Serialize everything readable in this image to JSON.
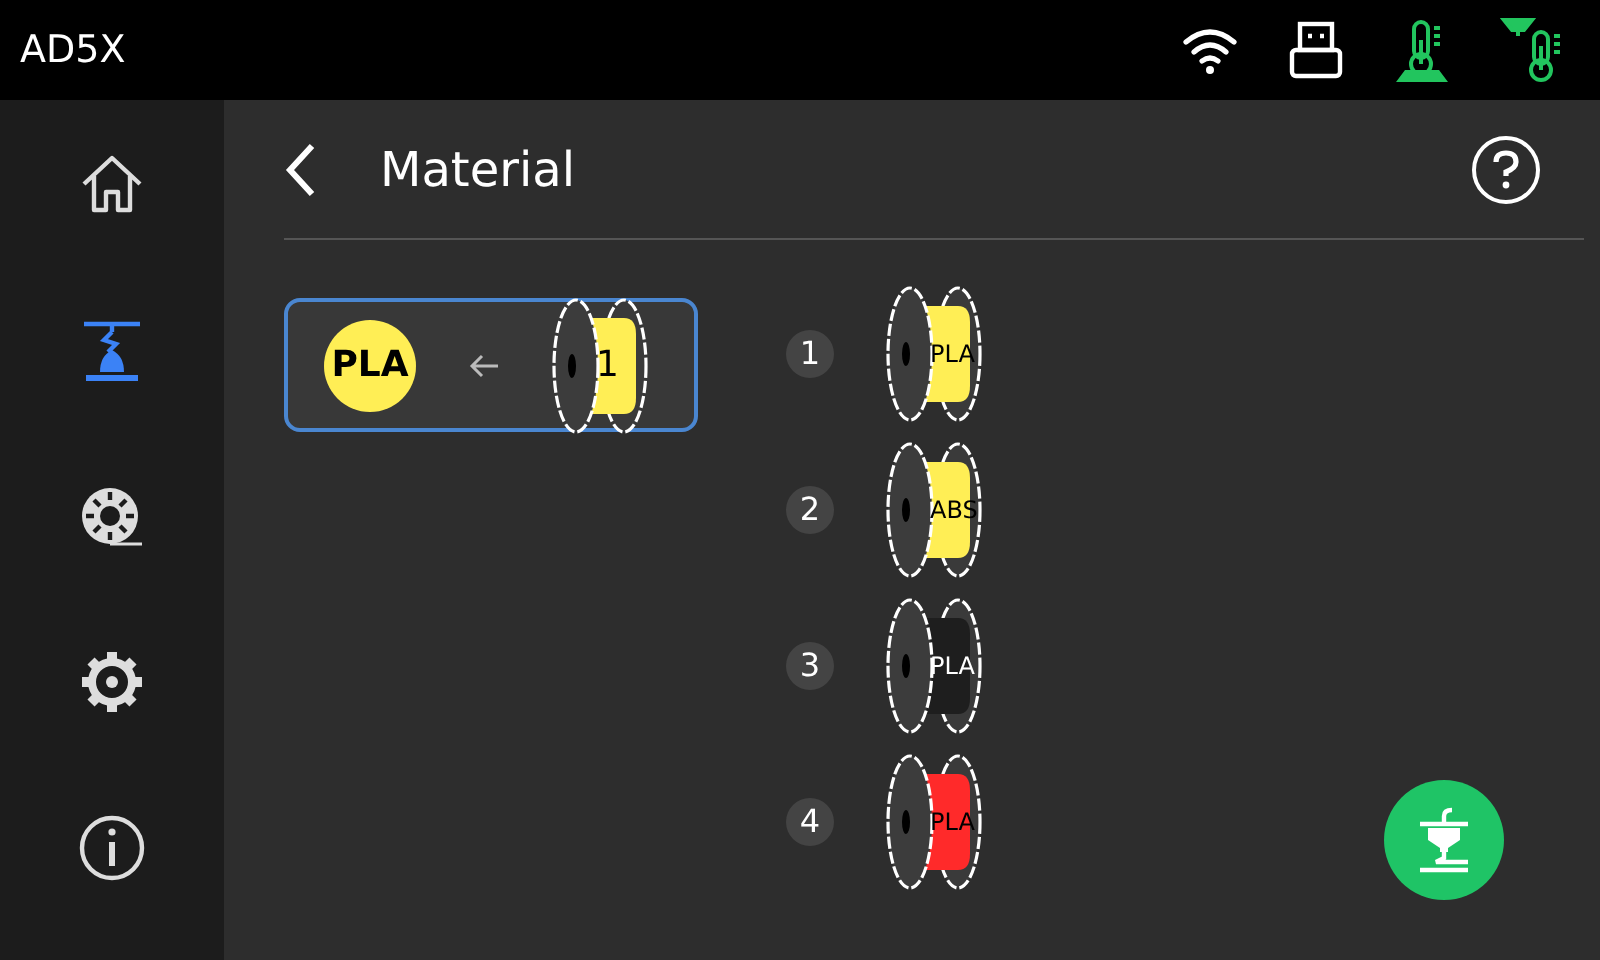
{
  "top_bar": {
    "title": "AD5X"
  },
  "sidebar": {
    "items": [
      {
        "kind": "home",
        "selected": false
      },
      {
        "kind": "print",
        "selected": true
      },
      {
        "kind": "filament",
        "selected": false
      },
      {
        "kind": "settings",
        "selected": false
      },
      {
        "kind": "info",
        "selected": false
      }
    ]
  },
  "header": {
    "title": "Material"
  },
  "active_slot": {
    "material": "PLA",
    "color": "#ffee55",
    "slot": "1"
  },
  "slots": [
    {
      "number": "1",
      "material": "PLA",
      "color": "#ffee55"
    },
    {
      "number": "2",
      "material": "ABS",
      "color": "#ffee55"
    },
    {
      "number": "3",
      "material": "PLA",
      "color": "#1e1e1e"
    },
    {
      "number": "4",
      "material": "PLA",
      "color": "#ff2a2a"
    }
  ]
}
